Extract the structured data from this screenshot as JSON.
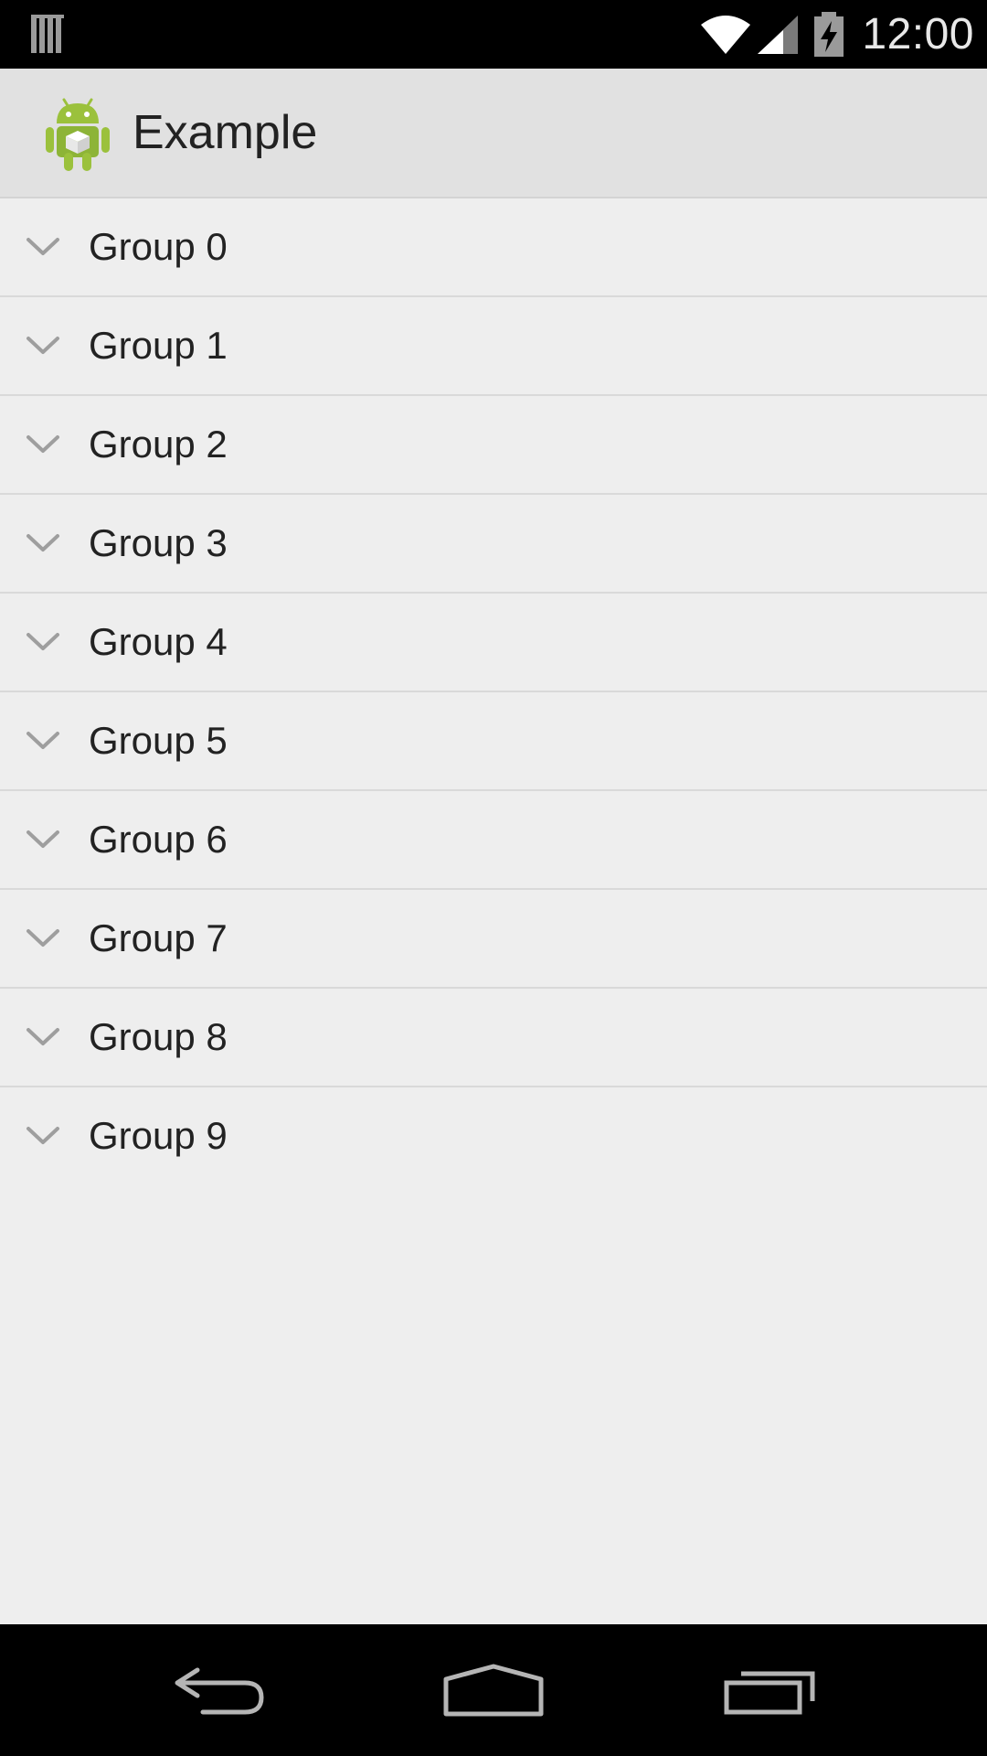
{
  "status_bar": {
    "time": "12:00",
    "icons": [
      "notification-bars-icon",
      "wifi-icon",
      "cell-signal-icon",
      "battery-charging-icon"
    ]
  },
  "action_bar": {
    "title": "Example",
    "icon": "android-app-icon"
  },
  "groups": [
    {
      "label": "Group 0"
    },
    {
      "label": "Group 1"
    },
    {
      "label": "Group 2"
    },
    {
      "label": "Group 3"
    },
    {
      "label": "Group 4"
    },
    {
      "label": "Group 5"
    },
    {
      "label": "Group 6"
    },
    {
      "label": "Group 7"
    },
    {
      "label": "Group 8"
    },
    {
      "label": "Group 9"
    }
  ],
  "nav_bar": {
    "buttons": [
      "back-icon",
      "home-icon",
      "recents-icon"
    ]
  },
  "colors": {
    "background": "#eeeeee",
    "action_bar": "#e1e1e1",
    "divider": "#d9d9d9",
    "text": "#222222",
    "chevron": "#9e9e9e",
    "android_green": "#9bc13c"
  }
}
